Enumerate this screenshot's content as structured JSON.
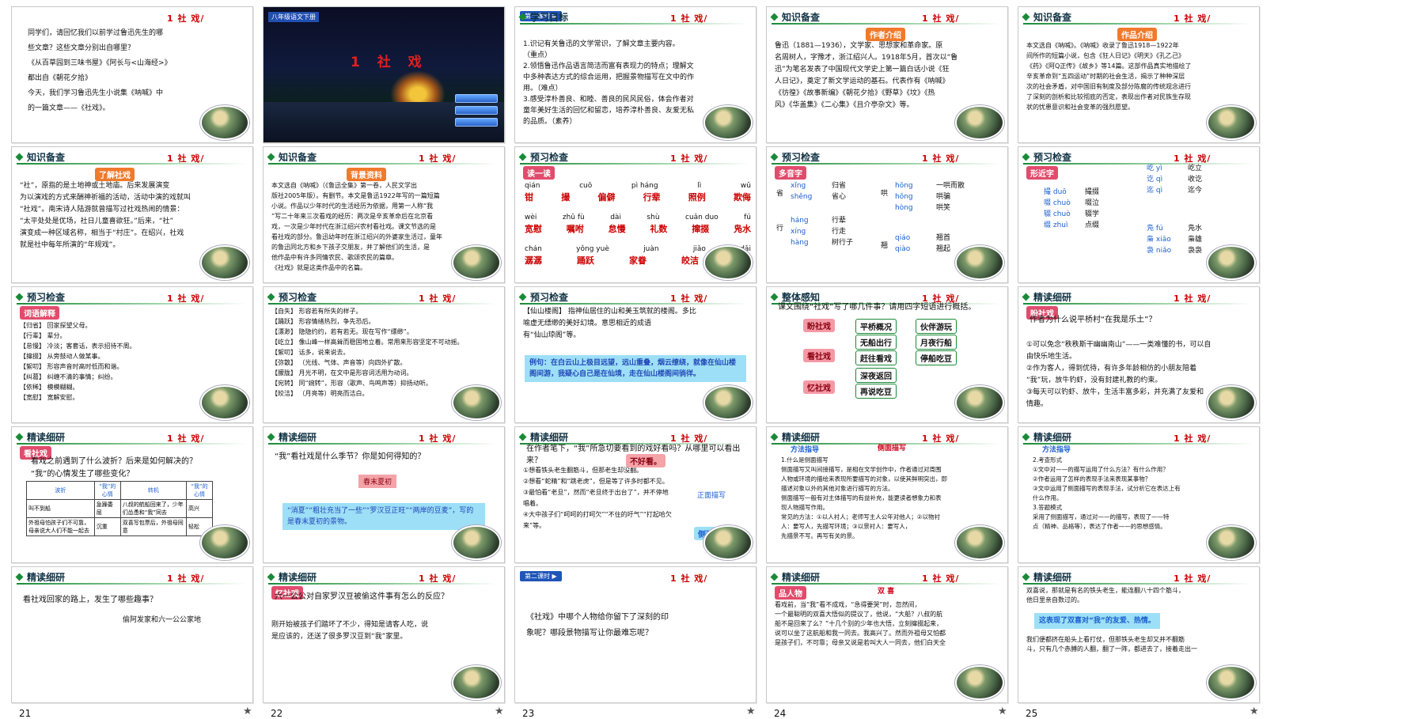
{
  "common": {
    "star": "★",
    "title": "1  社  戏/"
  },
  "slides": [
    {
      "n": "1",
      "lines": [
        "同学们，请回忆我们以前学过鲁迅先生的哪",
        "些文章？这些文章分别出自哪里？",
        "《从百草园到三味书屋》《阿长与<山海经>》",
        "都出自《朝花夕拾》",
        "今天，我们学习鲁迅先生小说集《呐喊》中",
        "的一篇文章——《社戏》。"
      ]
    },
    {
      "n": "2",
      "tag": "八年级语文下册",
      "big": "1 社  戏"
    },
    {
      "n": "3",
      "lesson": "第一课时 ▶",
      "head": "学习目标",
      "lines": [
        "1.识记有关鲁迅的文学常识，了解文章主要内容。",
        "（重点）",
        "2.领悟鲁迅作品语言简洁而富有表现力的特点；理解文",
        "中多种表达方式的综合运用，把握景物描写在文中的作",
        "用。（难点）",
        "3.感受淳朴善良、和睦、善良的民风民俗，体会作者对",
        "童年美好生活的回忆和留恋，培养淳朴善良、友爱无私",
        "的品质。（素养）"
      ]
    },
    {
      "n": "4",
      "head": "知识备查",
      "pill": "作者介绍",
      "lines": [
        "鲁迅（1881—1936），文学家、思想家和革命家。原",
        "名周树人，字豫才，浙江绍兴人。1918年5月，首次以“鲁",
        "迅”为笔名发表了中国现代文学史上第一篇白话小说《狂",
        "人日记》，奠定了新文学运动的基石。代表作有《呐喊》",
        "《彷徨》《故事新编》《朝花夕拾》《野草》《坟》《热",
        "风》《华盖集》《二心集》《且介亭杂文》等。"
      ]
    },
    {
      "n": "5",
      "head": "知识备查",
      "pill": "作品介绍",
      "lines": [
        "本文选自《呐喊》。《呐喊》收录了鲁迅1918—1922年",
        "间所作的短篇小说，包含《狂人日记》《明天》《孔乙己》",
        "《药》《阿Q正传》《故乡》等14篇。这部作品真实地描绘了",
        "辛亥革命到“五四运动”时期的社会生活，揭示了种种深层",
        "次的社会矛盾，对中国旧有制度及部分陈腐的传统观念进行",
        "了深刻的剖析和比较彻底的否定，表现出作者对民族生存现",
        "状的忧患意识和社会变革的强烈愿望。"
      ]
    },
    {
      "n": "6",
      "head": "知识备查",
      "pill": "了解社戏",
      "lines": [
        "“社”，原指的是土地神或土地庙。后来发展演变",
        "为以演戏的方式来酬神祈福的活动，活动中演的戏就叫",
        "“社戏”。南宋诗人陆游就曾描写过社戏热闹的情景：",
        "“太平处处是优场，社日儿童喜欲狂。”后来，“社”",
        "演变成一种区域名称，相当于“村庄”。在绍兴，社戏",
        "就是社中每年所演的“年规戏”。"
      ]
    },
    {
      "n": "7",
      "head": "知识备查",
      "pill": "背景资料",
      "lines": [
        "本文选自《呐喊》（《鲁迅全集》第一卷，人民文学出",
        "版社2005年版）。有删节。本文是鲁迅1922年写的一篇短篇",
        "小说。作品以少年时代的生活经历为依据，用第一人称“我",
        "”写二十年来三次看戏的经历：两次是辛亥革命后在北京看",
        "戏，一次是少年时代在浙江绍兴农村看社戏。课文节选的是",
        "看社戏的部分。鲁迅幼年时在浙江绍兴的外婆家生活过，童年",
        "的鲁迅同北方和乡下孩子交朋友，并了解他们的生活，是",
        "他作品中有许多同情农民、歌颂农民的篇章。",
        "《社戏》就是这类作品中的名篇。"
      ]
    },
    {
      "n": "8",
      "head": "预习检查",
      "pill": "读一读",
      "rows": [
        [
          "qián",
          "cuō",
          "pì  háng",
          "lì",
          "wǔ"
        ],
        [
          "钳",
          "撮",
          "偏僻",
          "行辈",
          "照例",
          "欺侮"
        ],
        [
          "wèi",
          "zhǔ fù",
          "dài",
          "shù",
          "cuān duo",
          "fú"
        ],
        [
          "宽慰",
          "嘱咐",
          "怠慢",
          "礼数",
          "撺掇",
          "凫水"
        ],
        [
          "chán",
          "yǒng yuè",
          "juàn",
          "jiǎo",
          "dǎi"
        ],
        [
          "潺潺",
          "踊跃",
          "家眷",
          "皎洁",
          "好歹"
        ]
      ]
    },
    {
      "n": "9",
      "head": "预习检查",
      "pill": "多音字",
      "groups": [
        {
          "ch": "省",
          "items": [
            [
              "xǐng",
              "归省"
            ],
            [
              "shěng",
              "省心"
            ]
          ]
        },
        {
          "ch": "行",
          "items": [
            [
              "háng",
              "行辈"
            ],
            [
              "xíng",
              "行走"
            ],
            [
              "hàng",
              "树行子"
            ]
          ]
        },
        {
          "ch": "哄",
          "items": [
            [
              "hōng",
              "一哄而散"
            ],
            [
              "hǒng",
              "哄骗"
            ],
            [
              "hòng",
              "哄笑"
            ]
          ]
        },
        {
          "ch": "翘",
          "items": [
            [
              "qiáo",
              "翘首"
            ],
            [
              "qiào",
              "翘起"
            ]
          ]
        }
      ]
    },
    {
      "n": "10",
      "head": "预习检查",
      "pill": "形近字",
      "groups": [
        {
          "ch": "",
          "items": [
            [
              "撮 duō",
              "撮掇"
            ],
            [
              "啜 chuò",
              "啜泣"
            ],
            [
              "辍 chuò",
              "辍学"
            ],
            [
              "缀 zhuì",
              "点缀"
            ]
          ]
        },
        {
          "ch": "",
          "items": [
            [
              "屹 yì",
              "屹立"
            ],
            [
              "讫 qì",
              "收讫"
            ],
            [
              "迄 qì",
              "迄今"
            ]
          ]
        },
        {
          "ch": "",
          "items": [
            [
              "凫 fú",
              "凫水"
            ],
            [
              "枭 xiāo",
              "枭雄"
            ],
            [
              "袅 niǎo",
              "袅袅"
            ]
          ]
        }
      ]
    },
    {
      "n": "11",
      "head": "预习检查",
      "pill": "词语解释",
      "lines": [
        "【归省】 回家探望父母。",
        "【行辈】 辈分。",
        "【怠慢】 冷淡；客套话，表示招待不周。",
        "【撺掇】 从旁鼓动人做某事。",
        "【絮叨】 形容声音时高时低而和谐。",
        "【纠葛】 纠缠不清的事情；纠纷。",
        "【依稀】 模模糊糊。",
        "【宽慰】 宽解安慰。"
      ]
    },
    {
      "n": "12",
      "head": "预习检查",
      "lines": [
        "【自失】 形容若有所失的样子。",
        "【踊跃】 形容情绪热烈，争先恐后。",
        "【漂渺】 隐隐约约，若有若无。现在写作“缥缈”。",
        "【屹立】 像山峰一样高耸而稳固地立着。常用来形容坚定不可动摇。",
        "【絮叨】 话多，说来说去。",
        "【弥散】 （光线、气体、声音等）向四外扩散。",
        "【朦胧】 月光不明，在文中是形容词活用为动词。",
        "【宛转】 同“婉转”，形容（歌声、鸟鸣声等）抑扬动听。",
        "【皎洁】 （月亮等）明亮而洁白。"
      ]
    },
    {
      "n": "13",
      "head": "预习检查",
      "lines": [
        "【仙山楼阁】 指神仙居住的山和美玉筑就的楼阁。多比",
        "喻虚无缥缈的美好幻境。意思相近的成语",
        "有“仙山琼阁”等。"
      ],
      "example": "例句：在白云山上极目远望，远山重叠，烟云缭绕，就像在仙山楼阁间游，我疑心自己是在仙境，走在仙山楼阁间徜徉。"
    },
    {
      "n": "14",
      "head": "整体感知",
      "q": "课文围绕“社戏”写了哪几件事？请用四字短语进行概括。",
      "left": [
        "盼社戏",
        "看社戏",
        "忆社戏"
      ],
      "mid": [
        "平桥概况",
        "无船出行",
        "赶往看戏",
        "深夜返回",
        "再说吃豆"
      ],
      "right": [
        "伙伴游玩",
        "月夜行船",
        "停船吃豆"
      ]
    },
    {
      "n": "15",
      "head": "精读细研",
      "pill": "盼社戏",
      "q": "作者为什么说平桥村“在我是乐土”？",
      "lines": [
        "①可以免念“秩秩斯干幽幽南山”——一类难懂的书，可以自",
        "由快乐地生活。",
        "②作为客人，得到优待，有许多年龄相仿的小朋友陪着",
        "“我”玩，放牛钓虾，没有封建礼教的约束。",
        "③每天可以钓虾、放牛，生活丰富多彩，并充满了友爱和",
        "情趣。"
      ]
    },
    {
      "n": "16",
      "head": "精读细研",
      "pill": "看社戏",
      "q1": "看戏之前遇到了什么波折？后来是如何解决的？",
      "q2": "“我”的心情发生了哪些变化？",
      "cols": [
        "波折",
        "“我”的心情",
        "转机",
        "“我”的心情"
      ],
      "cells": [
        [
          "叫不到船",
          "急躁委屈",
          "八叔的航船回来了，少年们怂恿和“我”同去",
          "高兴"
        ],
        [
          "外祖母怕孩子们不可靠，母亲说大人们不能一起去",
          "沉重",
          "双喜写包票后，外祖母同意",
          "轻松"
        ]
      ]
    },
    {
      "n": "17",
      "head": "精读细研",
      "q": "“我”看社戏是什么季节？你是如何得知的？",
      "box": "春末夏初",
      "ans": "“消夏”“粗壮充当了一些”“罗汉豆正旺”“两岸的豆麦”，写的是春末夏初的景物。"
    },
    {
      "n": "18",
      "head": "精读细研",
      "q": "在作者笔下，“我”所急切要看到的戏好看吗？从哪里可以看出来？",
      "tagbox": "不好看。",
      "lines": [
        "①想看铁头老生翻筋斗，但那老生却没翻。",
        "②想看“蛇精”和“跳老虎”，但是等了许多时都不见。",
        "③最怕看“老旦”，然而“老旦终于出台了”，并不停地唱着。",
        "④大中孩子们“呵呵的打呵欠”“不住的吁气”“打起哈欠来”等。"
      ],
      "tag1": "正面描写",
      "tag2": "侧面描写"
    },
    {
      "n": "19",
      "head": "精读细研",
      "red": "侧面描写",
      "title": "方法指导",
      "lines": [
        "1.什么是侧面描写",
        "侧面描写又叫间接描写，是相在文学创作中，作者通过对周围",
        "人物或环境的描绘来表现所要描写的对象，以使其鲜明突出，即",
        "描述对象以外的其他对象进行描写的方法。",
        "侧面描写一般有对主体描写的有益补充，能更读者想象力和表",
        "现人物描写作用。",
        "常见的方法：①以人衬人；老师写主人公年对他人；②以物衬",
        "人：要写人，先描写环境；③以景衬人：要写人，",
        "先描景不写。再写有关的景。"
      ]
    },
    {
      "n": "20",
      "head": "精读细研",
      "title": "方法指导",
      "lines": [
        "2.考查形式",
        "①文中对——的描写运用了什么方法？有什么作用？",
        "②作者运用了怎样的表现手法来表现某事物？",
        "③文中运用了侧面描写的表现手法，试分析它在表达上有",
        "什么作用。",
        "3.答题模式",
        "采用了侧面描写，通过对——的描写，表现了——特",
        "点（精神、品格等），表达了作者——的思想感情。"
      ]
    },
    {
      "n": "21",
      "head": "精读细研",
      "q": "看社戏回家的路上，发生了哪些趣事？",
      "lines": [
        "偷阿发家和六一公公家地"
      ]
    },
    {
      "n": "22",
      "head": "精读细研",
      "pill": "忆社戏",
      "q": "六一公公对自家罗汉豆被偷这件事有怎么的反应？",
      "lines": [
        "刚开始被孩子们踏坏了不少，得知是请客人吃，说",
        "是应该的，还送了很多罗汉豆到“我”家里。"
      ]
    },
    {
      "n": "23",
      "lesson": "第二课时 ▶",
      "q": "《社戏》中哪个人物给你留下了深刻的印",
      "q2": "象呢？哪段景物描写让你最难忘呢？"
    },
    {
      "n": "24",
      "head": "精读细研",
      "pill": "品人物",
      "red": "双  喜",
      "lines": [
        "看戏前，当“我”看不成戏，“急得要哭”时，忽然间，",
        "一个最聪明的双喜大悟似的提议了，他说，“大船？八叔的航",
        "船不是回来了么？”十几个别的少年也大悟，立刻撺掇起来，",
        "说可以坐了这航船和我一同去。我高兴了。然而外祖母又怕都",
        "是孩子们，不可靠；母亲又说是若叫大人一同去，他们白天全"
      ]
    },
    {
      "n": "25",
      "head": "精读细研",
      "lines": [
        "双喜说，那就是有名的铁头老生，能连翻八十四个筋斗，",
        "他日里亲自数过的。"
      ],
      "blue": "这表现了双喜对“我”的友爱、热情。",
      "lines2": [
        "我们便都挤在船头上看打仗，但那铁头老生却又并不翻筋",
        "斗，只有几个赤膊的人翻，翻了一阵，都进去了，接着走出一"
      ]
    }
  ]
}
